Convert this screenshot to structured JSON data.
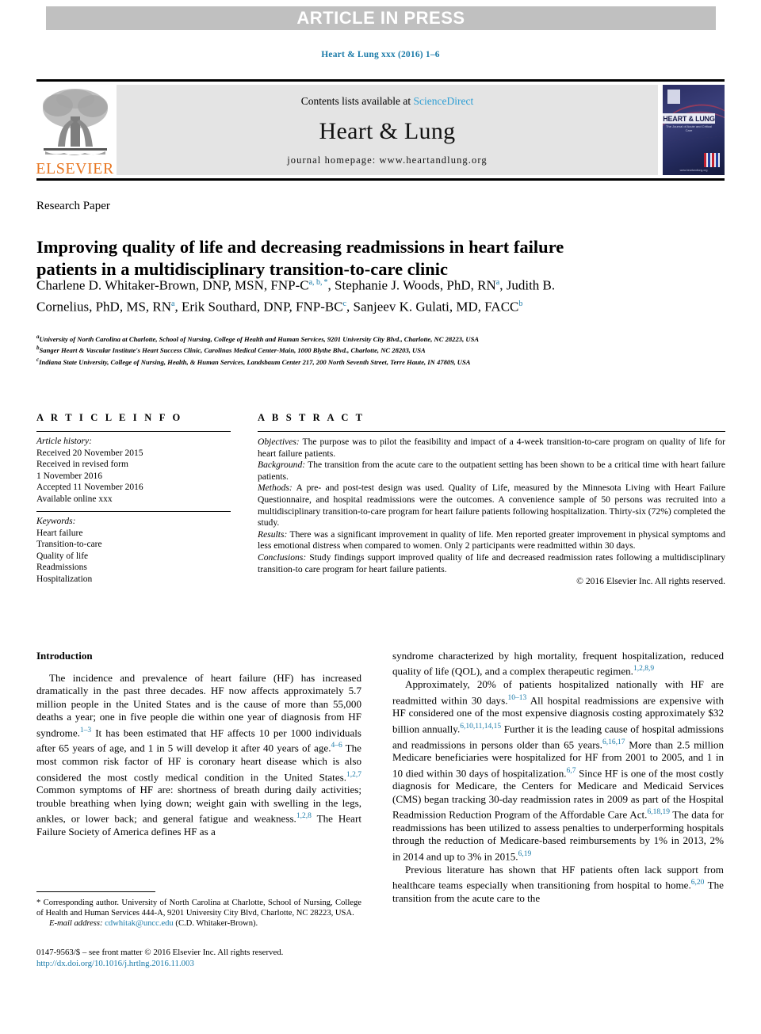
{
  "banner": {
    "text": "ARTICLE IN PRESS"
  },
  "running_head": {
    "text": "Heart & Lung xxx (2016) 1–6"
  },
  "masthead": {
    "publisher": "ELSEVIER",
    "contents_prefix": "Contents lists available at ",
    "contents_link": "ScienceDirect",
    "journal_title": "Heart & Lung",
    "homepage": "journal homepage: www.heartandlung.org",
    "cover_title": "HEART & LUNG",
    "cover_subtitle": "The Journal of Acute and Critical Care",
    "cover_url": "www.heartandlung.org"
  },
  "article": {
    "section_type": "Research Paper",
    "title": "Improving quality of life and decreasing readmissions in heart failure patients in a multidisciplinary transition-to-care clinic",
    "authors_html": "Charlene D. Whitaker-Brown, DNP, MSN, FNP-C<sup>a, b, *</sup>, Stephanie J. Woods, PhD, RN<sup>a</sup>, Judith B. Cornelius, PhD, MS, RN<sup>a</sup>, Erik Southard, DNP, FNP-BC<sup>c</sup>, Sanjeev K. Gulati, MD, FACC<sup>b</sup>",
    "affiliations": [
      {
        "mark": "a",
        "text": "University of North Carolina at Charlotte, School of Nursing, College of Health and Human Services, 9201 University City Blvd., Charlotte, NC 28223, USA"
      },
      {
        "mark": "b",
        "text": "Sanger Heart & Vascular Institute's Heart Success Clinic, Carolinas Medical Center-Main, 1000 Blythe Blvd., Charlotte, NC 28203, USA"
      },
      {
        "mark": "c",
        "text": "Indiana State University, College of Nursing, Health, & Human Services, Landsbaum Center 217, 200 North Seventh Street, Terre Haute, IN 47809, USA"
      }
    ]
  },
  "article_info": {
    "heading": "A R T I C L E   I N F O",
    "history_label": "Article history:",
    "history": [
      "Received 20 November 2015",
      "Received in revised form",
      "1 November 2016",
      "Accepted 11 November 2016",
      "Available online xxx"
    ],
    "keywords_label": "Keywords:",
    "keywords": [
      "Heart failure",
      "Transition-to-care",
      "Quality of life",
      "Readmissions",
      "Hospitalization"
    ]
  },
  "abstract": {
    "heading": "A B S T R A C T",
    "sections": [
      {
        "label": "Objectives:",
        "text": " The purpose was to pilot the feasibility and impact of a 4-week transition-to-care program on quality of life for heart failure patients."
      },
      {
        "label": "Background:",
        "text": " The transition from the acute care to the outpatient setting has been shown to be a critical time with heart failure patients."
      },
      {
        "label": "Methods:",
        "text": " A pre- and post-test design was used. Quality of Life, measured by the Minnesota Living with Heart Failure Questionnaire, and hospital readmissions were the outcomes. A convenience sample of 50 persons was recruited into a multidisciplinary transition-to-care program for heart failure patients following hospitalization. Thirty-six (72%) completed the study."
      },
      {
        "label": "Results:",
        "text": " There was a significant improvement in quality of life. Men reported greater improvement in physical symptoms and less emotional distress when compared to women. Only 2 participants were readmitted within 30 days."
      },
      {
        "label": "Conclusions:",
        "text": " Study findings support improved quality of life and decreased readmission rates following a multidisciplinary transition-to care program for heart failure patients."
      }
    ],
    "copyright": "© 2016 Elsevier Inc. All rights reserved."
  },
  "body": {
    "intro_heading": "Introduction",
    "left_paragraphs_html": [
      "The incidence and prevalence of heart failure (HF) has increased dramatically in the past three decades. HF now affects approximately 5.7 million people in the United States and is the cause of more than 55,000 deaths a year; one in five people die within one year of diagnosis from HF syndrome.<span class=\"ref\">1&#8211;3</span> It has been estimated that HF affects 10 per 1000 individuals after 65 years of age, and 1 in 5 will develop it after 40 years of age.<span class=\"ref\">4&#8211;6</span> The most common risk factor of HF is coronary heart disease which is also considered the most costly medical condition in the United States.<span class=\"ref\">1,2,7</span> Common symptoms of HF are: shortness of breath during daily activities; trouble breathing when lying down; weight gain with swelling in the legs, ankles, or lower back; and general fatigue and weakness.<span class=\"ref\">1,2,8</span> The Heart Failure Society of America defines HF as a"
    ],
    "right_paragraphs_html": [
      "syndrome characterized by high mortality, frequent hospitalization, reduced quality of life (QOL), and a complex therapeutic regimen.<span class=\"ref\">1,2,8,9</span>",
      "Approximately, 20% of patients hospitalized nationally with HF are readmitted within 30 days.<span class=\"ref\">10&#8211;13</span> All hospital readmissions are expensive with HF considered one of the most expensive diagnosis costing approximately $32 billion annually.<span class=\"ref\">6,10,11,14,15</span> Further it is the leading cause of hospital admissions and readmissions in persons older than 65 years.<span class=\"ref\">6,16,17</span> More than 2.5 million Medicare beneficiaries were hospitalized for HF from 2001 to 2005, and 1 in 10 died within 30 days of hospitalization.<span class=\"ref\">6,7</span> Since HF is one of the most costly diagnosis for Medicare, the Centers for Medicare and Medicaid Services (CMS) began tracking 30-day readmission rates in 2009 as part of the Hospital Readmission Reduction Program of the Affordable Care Act.<span class=\"ref\">6,18,19</span> The data for readmissions has been utilized to assess penalties to underperforming hospitals through the reduction of Medicare-based reimbursements by 1% in 2013, 2% in 2014 and up to 3% in 2015.<span class=\"ref\">6,19</span>",
      "Previous literature has shown that HF patients often lack support from healthcare teams especially when transitioning from hospital to home.<span class=\"ref\">6,20</span> The transition from the acute care to the"
    ]
  },
  "footnotes": {
    "corresponding_html": "* Corresponding author. University of North Carolina at Charlotte, School of Nursing, College of Health and Human Services 444-A, 9201 University City Blvd, Charlotte, NC 28223, USA.",
    "email_label": "E-mail address:",
    "email": "cdwhitak@uncc.edu",
    "email_owner": "(C.D. Whitaker-Brown).",
    "issn_line": "0147-9563/$ – see front matter © 2016 Elsevier Inc. All rights reserved.",
    "doi": "http://dx.doi.org/10.1016/j.hrtlng.2016.11.003"
  },
  "colors": {
    "link_blue": "#1a7aa8",
    "sciencedirect_blue": "#2e9ed4",
    "elsevier_orange": "#e87722",
    "banner_gray": "#c0c0c0",
    "masthead_gray": "#e4e4e4"
  }
}
